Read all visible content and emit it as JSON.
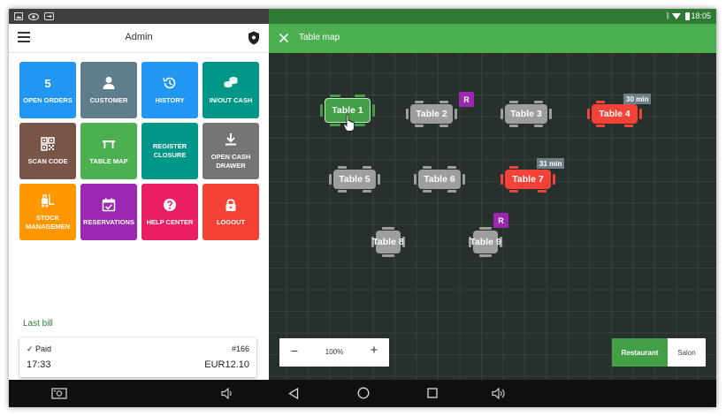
{
  "admin_panel": {
    "title": "Admin",
    "tiles": [
      {
        "label": "OPEN ORDERS",
        "count": "5",
        "icon": "count",
        "color": "#2196f3"
      },
      {
        "label": "CUSTOMER",
        "icon": "person-icon",
        "color": "#607d8b"
      },
      {
        "label": "HISTORY",
        "icon": "history-icon",
        "color": "#2196f3"
      },
      {
        "label": "IN/OUT CASH",
        "icon": "coins-icon",
        "color": "#009688"
      },
      {
        "label": "SCAN CODE",
        "icon": "qr-code-icon",
        "color": "#795548"
      },
      {
        "label": "TABLE MAP",
        "icon": "table-icon",
        "color": "#4caf50"
      },
      {
        "label": "REGISTER CLOSURE",
        "icon": "",
        "color": "#009688"
      },
      {
        "label": "OPEN CASH DRAWER",
        "icon": "download-icon",
        "color": "#757575"
      },
      {
        "label": "STOCK MANAGEMEN",
        "icon": "forklift-icon",
        "color": "#ff9800"
      },
      {
        "label": "RESERVATIONS",
        "icon": "calendar-check-icon",
        "color": "#9c27b0"
      },
      {
        "label": "HELP CENTER",
        "icon": "help-icon",
        "color": "#e91e63"
      },
      {
        "label": "LOGOUT",
        "icon": "lock-icon",
        "color": "#f44336"
      }
    ],
    "last_bill_label": "Last bill",
    "last_bill": {
      "status": "Paid",
      "number": "#166",
      "time": "17:33",
      "amount": "EUR12.10"
    }
  },
  "table_map": {
    "title": "Table map",
    "tables": [
      {
        "name": "Table 1",
        "state": "selected",
        "color": "#43a047"
      },
      {
        "name": "Table 2",
        "state": "free",
        "color": "#9e9e9e",
        "badge": "R"
      },
      {
        "name": "Table 3",
        "state": "free",
        "color": "#9e9e9e"
      },
      {
        "name": "Table 4",
        "state": "occupied",
        "color": "#f44336",
        "timer": "30 min"
      },
      {
        "name": "Table 5",
        "state": "free",
        "color": "#9e9e9e"
      },
      {
        "name": "Table 6",
        "state": "free",
        "color": "#9e9e9e"
      },
      {
        "name": "Table 7",
        "state": "occupied",
        "color": "#f44336",
        "timer": "31 min"
      },
      {
        "name": "Table 8",
        "state": "free",
        "color": "#9e9e9e"
      },
      {
        "name": "Table 9",
        "state": "free",
        "color": "#9e9e9e",
        "badge": "R"
      }
    ],
    "zoom": {
      "value": "100%"
    },
    "rooms": [
      {
        "label": "Restaurant",
        "active": true
      },
      {
        "label": "Salon",
        "active": false
      }
    ]
  },
  "status_bar": {
    "time": "18:05"
  },
  "colors": {
    "reservation_badge": "#9c27b0",
    "timer_badge": "#6f7f87",
    "map_background": "#27302d",
    "accent": "#4caf50"
  }
}
